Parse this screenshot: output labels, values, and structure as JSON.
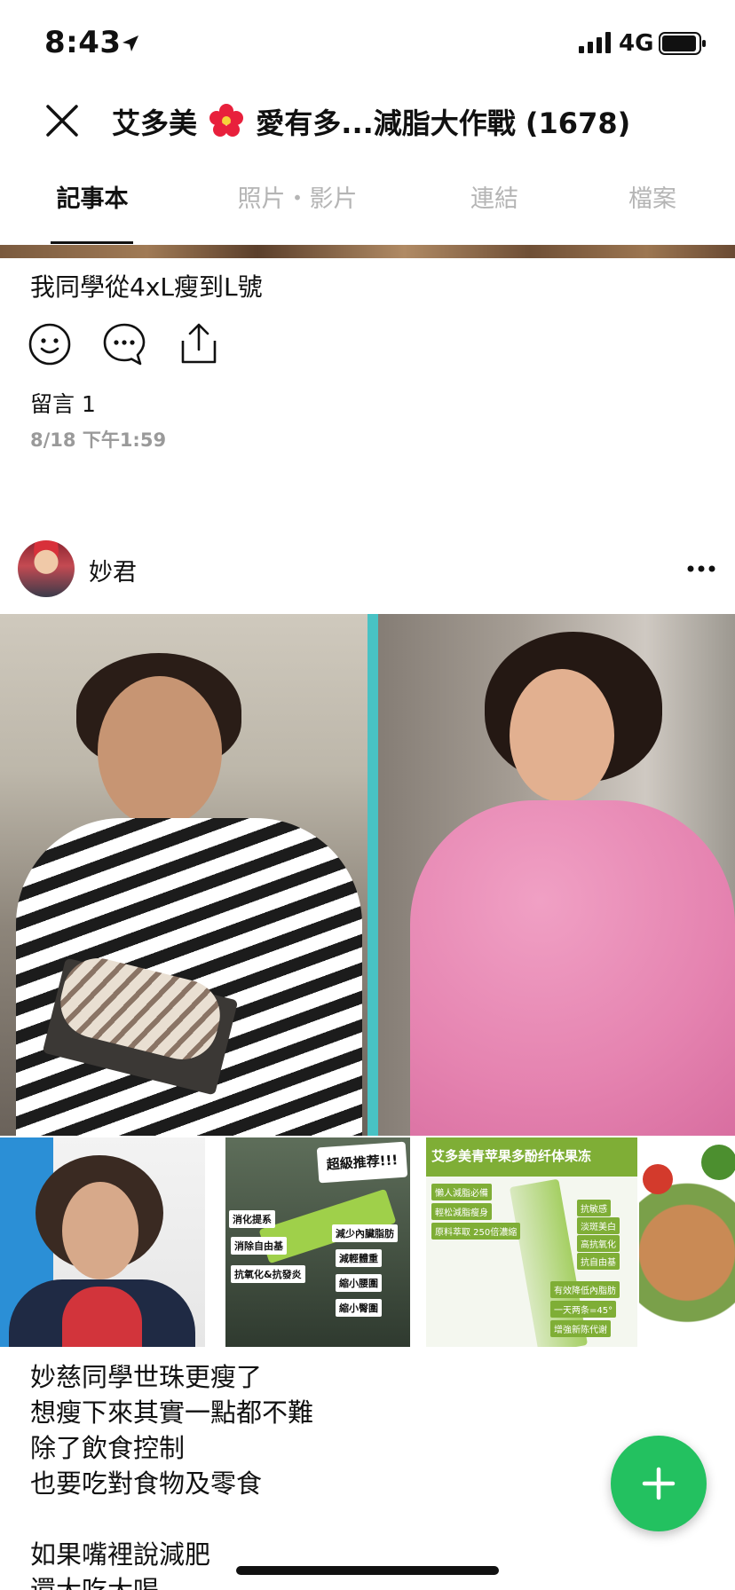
{
  "status_bar": {
    "time": "8:43",
    "network": "4G",
    "icons": [
      "location-arrow-icon",
      "signal-icon",
      "battery-icon"
    ]
  },
  "header": {
    "title_part1": "艾多美",
    "title_part2": "愛有多...減脂大作戰 (1678)",
    "close_icon": "close-icon",
    "flower_icon": "hibiscus-emoji"
  },
  "tabs": [
    {
      "label": "記事本",
      "active": true
    },
    {
      "label": "照片・影片",
      "active": false
    },
    {
      "label": "連結",
      "active": false
    },
    {
      "label": "檔案",
      "active": false
    }
  ],
  "post1": {
    "text": "我同學從4xL瘦到L號",
    "actions": [
      "smile-icon",
      "comment-icon",
      "share-icon"
    ],
    "comments": "留言 1",
    "date": "8/18 下午1:59"
  },
  "post2": {
    "author": "妙君",
    "more_icon": "more-icon",
    "thumb2_banner": "超級推荐!!!",
    "thumb2_labels": [
      "消化提系",
      "減少內臟脂肪",
      "消除自由基",
      "減輕體重",
      "抗氧化&抗發炎",
      "縮小腰圍",
      "縮小臀圍"
    ],
    "thumb3_title": "艾多美青苹果多酚纤体果冻",
    "thumb3_chips": [
      "懶人減脂必備",
      "輕松減脂瘦身",
      "原料萃取 250倍濃縮",
      "抗敏感",
      "淡斑美白",
      "高抗氧化",
      "抗自由基",
      "有效降低內脂肪",
      "一天两条=45°",
      "增強新陈代谢"
    ],
    "caption_lines": [
      "妙慈同學世珠更瘦了",
      "想瘦下來其實一點都不難",
      "除了飲食控制",
      "也要吃對食物及零食",
      "",
      "如果嘴裡說減肥",
      "還大吃大喝"
    ]
  },
  "fab": {
    "icon": "plus-icon",
    "color": "#23c160"
  },
  "colors": {
    "accent": "#23c160",
    "inactive_tab": "#b5b5b5",
    "date": "#9a9a9a"
  }
}
